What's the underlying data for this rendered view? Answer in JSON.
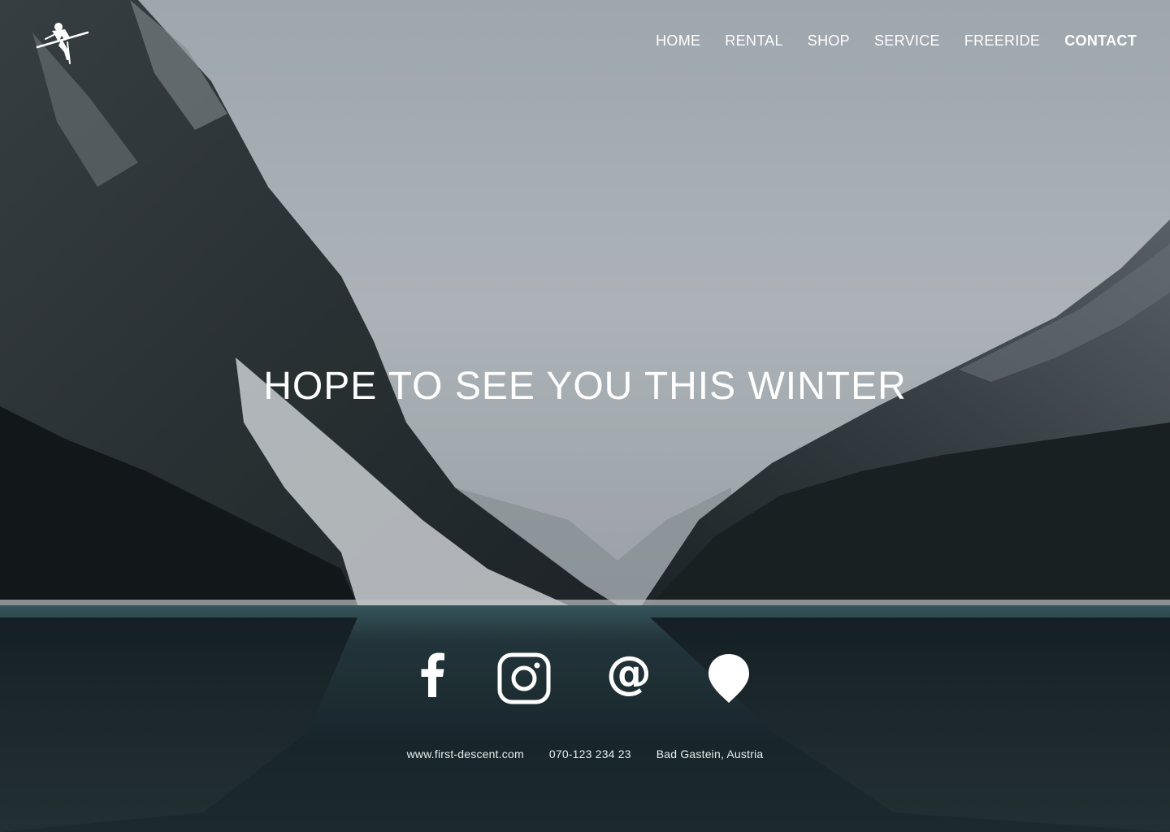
{
  "brand": {
    "logo_icon": "freeride-skier-logo-icon"
  },
  "nav": {
    "items": [
      {
        "label": "HOME",
        "active": false
      },
      {
        "label": "RENTAL",
        "active": false
      },
      {
        "label": "SHOP",
        "active": false
      },
      {
        "label": "SERVICE",
        "active": false
      },
      {
        "label": "FREERIDE",
        "active": false
      },
      {
        "label": "CONTACT",
        "active": true
      }
    ]
  },
  "hero": {
    "headline": "HOPE TO SEE YOU THIS WINTER"
  },
  "social": {
    "icons": [
      "facebook-icon",
      "instagram-icon",
      "email-at-icon",
      "location-pin-icon"
    ]
  },
  "contact": {
    "website": "www.first-descent.com",
    "phone": "070-123 234 23",
    "location": "Bad Gastein, Austria"
  },
  "colors": {
    "text": "#ffffff",
    "sky": "#b4bcc3",
    "water": "#1c2c34"
  }
}
